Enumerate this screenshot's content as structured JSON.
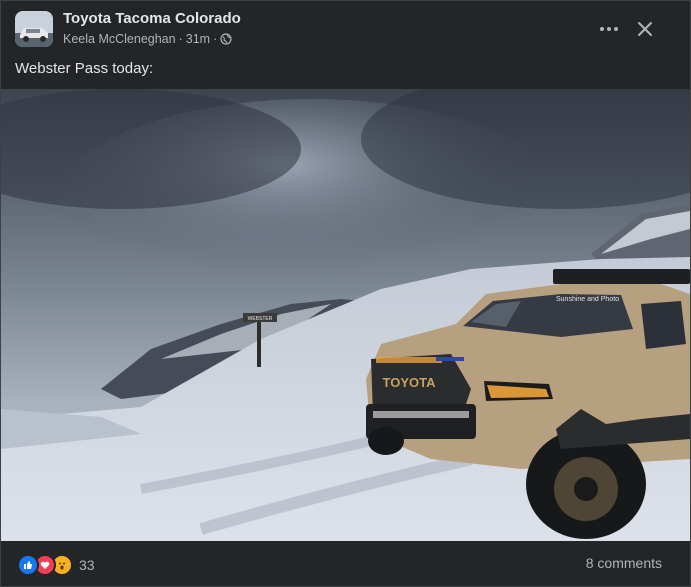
{
  "post": {
    "group_name": "Toyota Tacoma Colorado",
    "author": "Keela McCleneghan",
    "separator": "·",
    "time": "31m",
    "privacy_icon": "globe-icon",
    "caption": "Webster Pass today:"
  },
  "photo": {
    "sign_text": "WEBSTER",
    "grille_text": "TOYOTA",
    "windshield_text": "Sunshine and Photo"
  },
  "reactions": {
    "types": [
      "like-icon",
      "love-icon",
      "wow-icon"
    ],
    "count": "33"
  },
  "comments_label": "8 comments",
  "colors": {
    "card_bg": "#242526",
    "primary_text": "#e4e6eb",
    "secondary_text": "#b0b3b8",
    "like": "#1877f2",
    "love": "#f33e58",
    "wow": "#f7b125"
  }
}
